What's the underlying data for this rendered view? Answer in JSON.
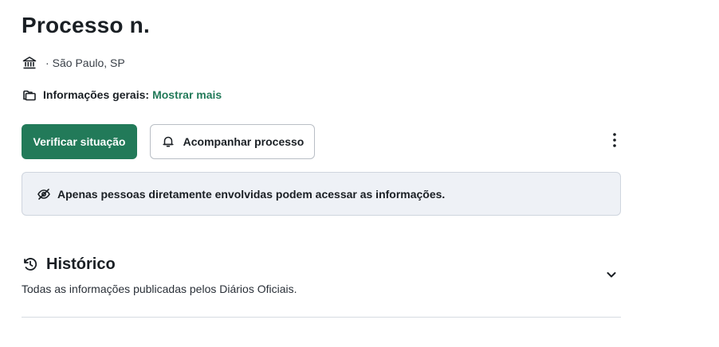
{
  "header": {
    "title": "Processo n."
  },
  "court": {
    "icon": "courthouse-icon",
    "separator": "·",
    "location": "São Paulo, SP"
  },
  "info": {
    "icon": "folder-icon",
    "label": "Informações gerais:",
    "more_link": "Mostrar mais"
  },
  "actions": {
    "primary_label": "Verificar situação",
    "secondary_label": "Acompanhar processo",
    "secondary_icon": "bell-icon",
    "more_icon": "kebab-menu-icon"
  },
  "notice": {
    "icon": "eye-off-icon",
    "text": "Apenas pessoas diretamente envolvidas podem acessar as informações."
  },
  "history": {
    "icon": "history-icon",
    "title": "Histórico",
    "subtitle": "Todas as informações publicadas pelos Diários Oficiais.",
    "toggle_icon": "chevron-down-icon"
  },
  "colors": {
    "accent": "#227a59",
    "notice_bg": "#eef1f6",
    "text": "#1a1f24"
  }
}
